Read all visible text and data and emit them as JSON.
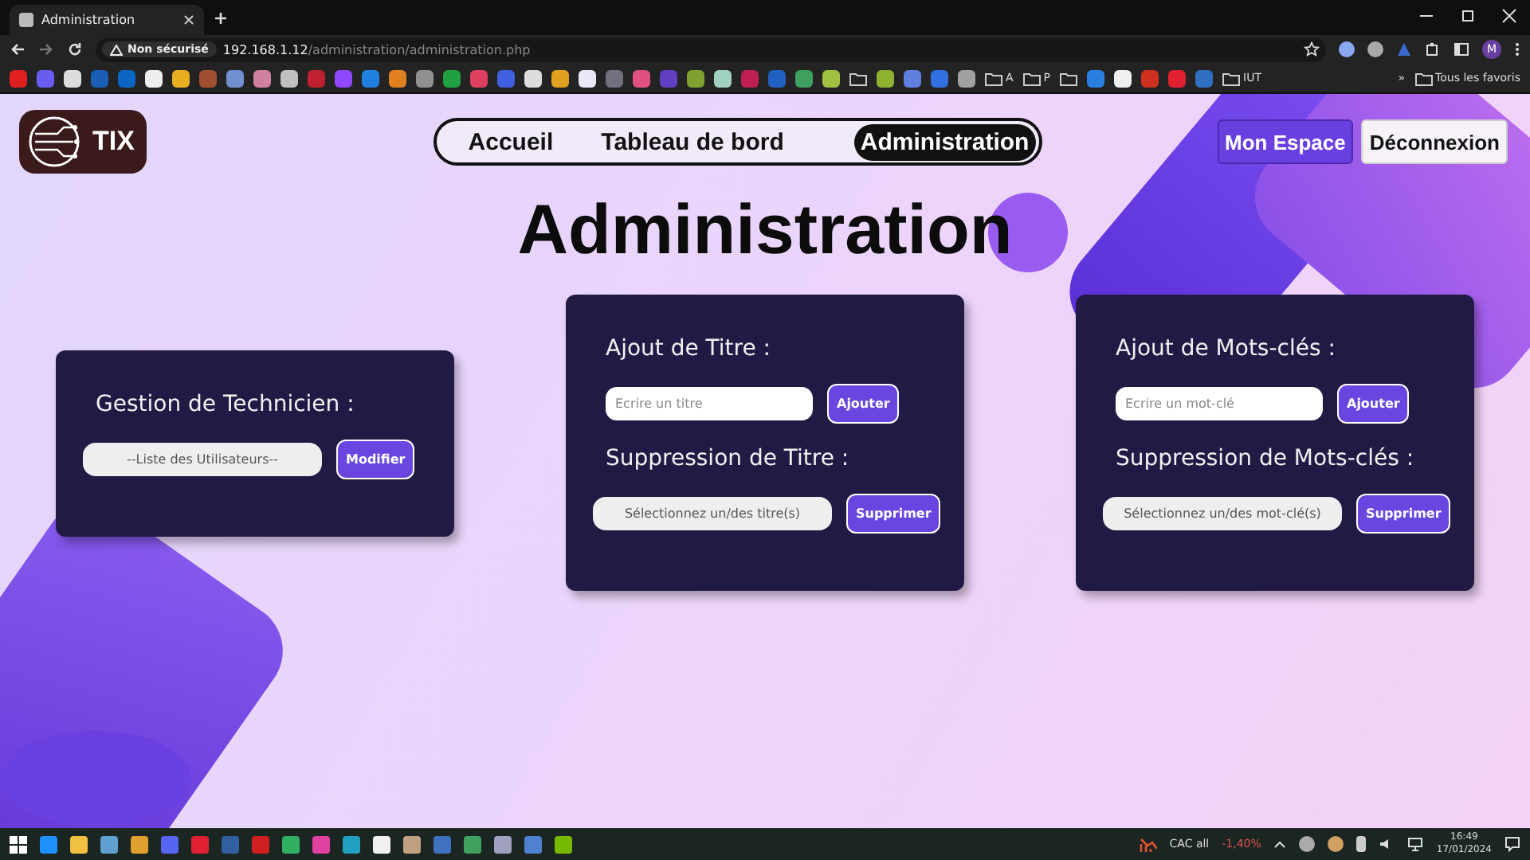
{
  "browser": {
    "tab_title": "Administration",
    "security_label": "Non sécurisé",
    "url_host": "192.168.1.12",
    "url_path": "/administration/administration.php",
    "profile_initial": "M",
    "all_bookmarks": "Tous les favoris",
    "overflow": "»",
    "bookmarks": [
      {
        "kind": "site",
        "color": "#e02020"
      },
      {
        "kind": "site",
        "color": "#6a5cf0"
      },
      {
        "kind": "site",
        "color": "#dddddd"
      },
      {
        "kind": "site",
        "color": "#1a5fb4"
      },
      {
        "kind": "site",
        "color": "#0a66c2"
      },
      {
        "kind": "site",
        "color": "#eeeeee"
      },
      {
        "kind": "site",
        "color": "#e8b020"
      },
      {
        "kind": "site",
        "color": "#a05030"
      },
      {
        "kind": "site",
        "color": "#7090d0"
      },
      {
        "kind": "site",
        "color": "#d080a0"
      },
      {
        "kind": "site",
        "color": "#c0c0c0"
      },
      {
        "kind": "site",
        "color": "#c02030"
      },
      {
        "kind": "site",
        "color": "#9146ff"
      },
      {
        "kind": "site",
        "color": "#2080e0"
      },
      {
        "kind": "site",
        "color": "#e08020"
      },
      {
        "kind": "site",
        "color": "#909090"
      },
      {
        "kind": "site",
        "color": "#20a040"
      },
      {
        "kind": "site",
        "color": "#e04060"
      },
      {
        "kind": "site",
        "color": "#4060e0"
      },
      {
        "kind": "site",
        "color": "#dddddd"
      },
      {
        "kind": "site",
        "color": "#e0a020"
      },
      {
        "kind": "site",
        "color": "#e8e8f8"
      },
      {
        "kind": "site",
        "color": "#707080"
      },
      {
        "kind": "site",
        "color": "#e05080"
      },
      {
        "kind": "site",
        "color": "#6040c0"
      },
      {
        "kind": "site",
        "color": "#80a030"
      },
      {
        "kind": "site",
        "color": "#a0d0c0"
      },
      {
        "kind": "site",
        "color": "#c02050"
      },
      {
        "kind": "site",
        "color": "#2060c0"
      },
      {
        "kind": "site",
        "color": "#40a060"
      },
      {
        "kind": "site",
        "color": "#a0c040"
      },
      {
        "kind": "folder"
      },
      {
        "kind": "site",
        "color": "#90b030"
      },
      {
        "kind": "site",
        "color": "#6080e0"
      },
      {
        "kind": "site",
        "color": "#3070e0"
      },
      {
        "kind": "site",
        "color": "#a0a0a0"
      },
      {
        "kind": "folder",
        "label": "A"
      },
      {
        "kind": "folder",
        "label": "P"
      },
      {
        "kind": "folder"
      },
      {
        "kind": "site",
        "color": "#2a80e0"
      },
      {
        "kind": "site",
        "color": "#f0f0f0"
      },
      {
        "kind": "site",
        "color": "#d03020"
      },
      {
        "kind": "site",
        "color": "#e02030"
      },
      {
        "kind": "site",
        "color": "#3070c0"
      },
      {
        "kind": "folder",
        "label": "IUT"
      }
    ]
  },
  "header": {
    "logo_text": "TIX",
    "nav": [
      {
        "label": "Accueil",
        "selected": false
      },
      {
        "label": "Tableau de bord",
        "selected": false
      },
      {
        "label": "Administration",
        "selected": true
      }
    ],
    "buttons": [
      {
        "label": "Mon Espace",
        "kind": "primary"
      },
      {
        "label": "Déconnexion",
        "kind": "secondary"
      }
    ]
  },
  "page_title": "Administration",
  "cards": [
    {
      "sections": [
        {
          "heading": "Gestion de Technicien :",
          "control": {
            "kind": "select",
            "text": "--Liste des Utilisateurs--"
          },
          "button": "Modifier"
        }
      ]
    },
    {
      "sections": [
        {
          "heading": "Ajout de Titre :",
          "control": {
            "kind": "input",
            "placeholder": "Ecrire un titre"
          },
          "button": "Ajouter"
        },
        {
          "heading": "Suppression de Titre :",
          "control": {
            "kind": "select",
            "text": "Sélectionnez un/des titre(s)"
          },
          "button": "Supprimer"
        }
      ]
    },
    {
      "sections": [
        {
          "heading": "Ajout de Mots-clés :",
          "control": {
            "kind": "input",
            "placeholder": "Ecrire un mot-clé"
          },
          "button": "Ajouter"
        },
        {
          "heading": "Suppression de Mots-clés :",
          "control": {
            "kind": "select",
            "text": "Sélectionnez un/des mot-clé(s)"
          },
          "button": "Supprimer"
        }
      ]
    }
  ],
  "taskbar": {
    "ticker_name": "CAC all",
    "ticker_change": "-1,40%",
    "time": "16:49",
    "date": "17/01/2024"
  }
}
